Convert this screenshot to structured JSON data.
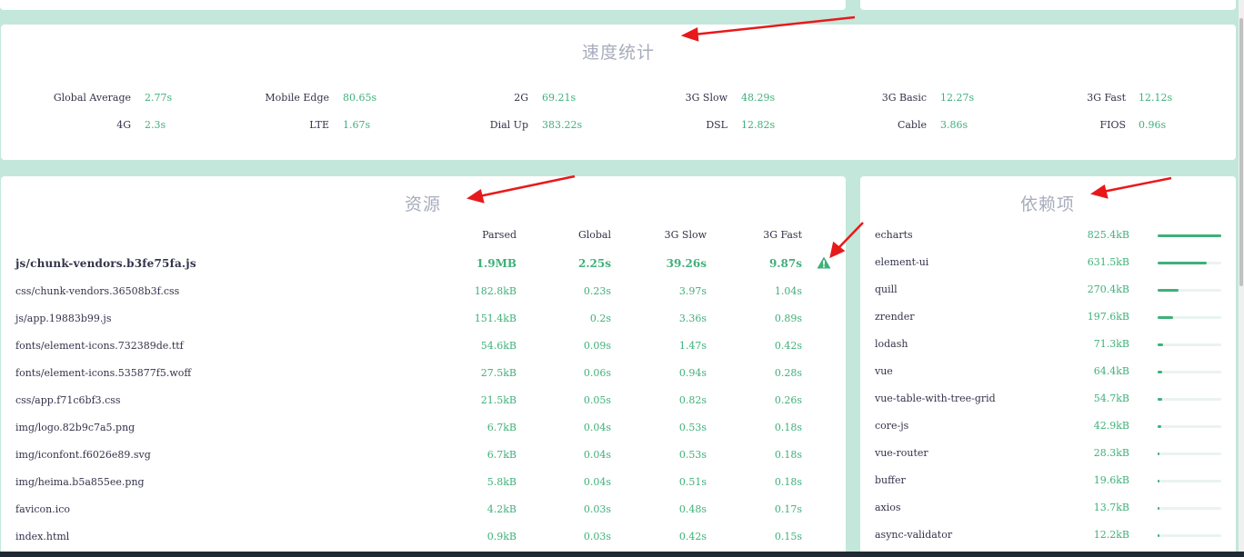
{
  "speed": {
    "title": "速度统计",
    "rows": [
      [
        {
          "label": "Global Average",
          "value": "2.77s"
        },
        {
          "label": "Mobile Edge",
          "value": "80.65s"
        },
        {
          "label": "2G",
          "value": "69.21s"
        },
        {
          "label": "3G Slow",
          "value": "48.29s"
        },
        {
          "label": "3G Basic",
          "value": "12.27s"
        },
        {
          "label": "3G Fast",
          "value": "12.12s"
        }
      ],
      [
        {
          "label": "4G",
          "value": "2.3s"
        },
        {
          "label": "LTE",
          "value": "1.67s"
        },
        {
          "label": "Dial Up",
          "value": "383.22s"
        },
        {
          "label": "DSL",
          "value": "12.82s"
        },
        {
          "label": "Cable",
          "value": "3.86s"
        },
        {
          "label": "FIOS",
          "value": "0.96s"
        }
      ]
    ]
  },
  "assets": {
    "title": "资源",
    "headers": [
      "Parsed",
      "Global",
      "3G Slow",
      "3G Fast"
    ],
    "rows": [
      {
        "name": "js/chunk-vendors.b3fe75fa.js",
        "parsed": "1.9MB",
        "global": "2.25s",
        "slow": "39.26s",
        "fast": "9.87s",
        "warning": true
      },
      {
        "name": "css/chunk-vendors.36508b3f.css",
        "parsed": "182.8kB",
        "global": "0.23s",
        "slow": "3.97s",
        "fast": "1.04s"
      },
      {
        "name": "js/app.19883b99.js",
        "parsed": "151.4kB",
        "global": "0.2s",
        "slow": "3.36s",
        "fast": "0.89s"
      },
      {
        "name": "fonts/element-icons.732389de.ttf",
        "parsed": "54.6kB",
        "global": "0.09s",
        "slow": "1.47s",
        "fast": "0.42s"
      },
      {
        "name": "fonts/element-icons.535877f5.woff",
        "parsed": "27.5kB",
        "global": "0.06s",
        "slow": "0.94s",
        "fast": "0.28s"
      },
      {
        "name": "css/app.f71c6bf3.css",
        "parsed": "21.5kB",
        "global": "0.05s",
        "slow": "0.82s",
        "fast": "0.26s"
      },
      {
        "name": "img/logo.82b9c7a5.png",
        "parsed": "6.7kB",
        "global": "0.04s",
        "slow": "0.53s",
        "fast": "0.18s"
      },
      {
        "name": "img/iconfont.f6026e89.svg",
        "parsed": "6.7kB",
        "global": "0.04s",
        "slow": "0.53s",
        "fast": "0.18s"
      },
      {
        "name": "img/heima.b5a855ee.png",
        "parsed": "5.8kB",
        "global": "0.04s",
        "slow": "0.51s",
        "fast": "0.18s"
      },
      {
        "name": "favicon.ico",
        "parsed": "4.2kB",
        "global": "0.03s",
        "slow": "0.48s",
        "fast": "0.17s"
      },
      {
        "name": "index.html",
        "parsed": "0.9kB",
        "global": "0.03s",
        "slow": "0.42s",
        "fast": "0.15s"
      }
    ]
  },
  "deps": {
    "title": "依赖项",
    "items": [
      {
        "name": "echarts",
        "size": "825.4kB",
        "ratio": 1.0
      },
      {
        "name": "element-ui",
        "size": "631.5kB",
        "ratio": 0.765
      },
      {
        "name": "quill",
        "size": "270.4kB",
        "ratio": 0.328
      },
      {
        "name": "zrender",
        "size": "197.6kB",
        "ratio": 0.239
      },
      {
        "name": "lodash",
        "size": "71.3kB",
        "ratio": 0.086
      },
      {
        "name": "vue",
        "size": "64.4kB",
        "ratio": 0.078
      },
      {
        "name": "vue-table-with-tree-grid",
        "size": "54.7kB",
        "ratio": 0.066
      },
      {
        "name": "core-js",
        "size": "42.9kB",
        "ratio": 0.052
      },
      {
        "name": "vue-router",
        "size": "28.3kB",
        "ratio": 0.034
      },
      {
        "name": "buffer",
        "size": "19.6kB",
        "ratio": 0.024
      },
      {
        "name": "axios",
        "size": "13.7kB",
        "ratio": 0.017
      },
      {
        "name": "async-validator",
        "size": "12.2kB",
        "ratio": 0.015
      }
    ]
  },
  "colors": {
    "background": "#c3e7db",
    "value_green": "#3fb079",
    "arrow_red": "#e8191b",
    "title_gray": "#a7adbc"
  },
  "icons": {
    "warning": "warning-triangle-icon"
  }
}
